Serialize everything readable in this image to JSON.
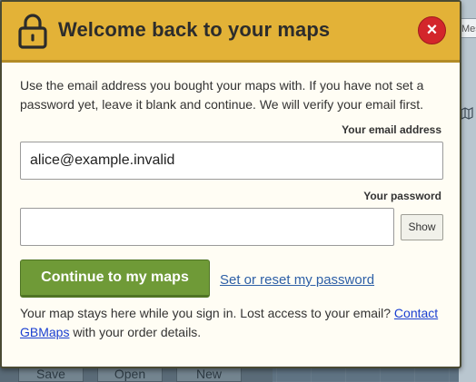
{
  "background": {
    "side_tab_label": "Mes",
    "toolbar": [
      "Save",
      "Open",
      "New"
    ]
  },
  "modal": {
    "title": "Welcome back to your maps",
    "close_label": "×",
    "intro": "Use the email address you bought your maps with. If you have not set a password yet, leave it blank and continue. We will verify your email first.",
    "email": {
      "label": "Your email address",
      "value": "alice@example.invalid"
    },
    "password": {
      "label": "Your password",
      "value": "",
      "show_label": "Show"
    },
    "primary_button": "Continue to my maps",
    "reset_link": "Set or reset my password",
    "footer": {
      "before_link": "Your map stays here while you sign in. Lost access to your email? ",
      "link": "Contact GBMaps",
      "after_link": " with your order details."
    }
  },
  "icons": {
    "header": "lock-icon",
    "close": "close-icon",
    "map": "map-icon"
  },
  "colors": {
    "header_bg": "#e3b237",
    "close_bg": "#d3262b",
    "primary_bg": "#6f9a37",
    "link": "#1a3fd1",
    "modal_bg": "#fffdf4"
  }
}
